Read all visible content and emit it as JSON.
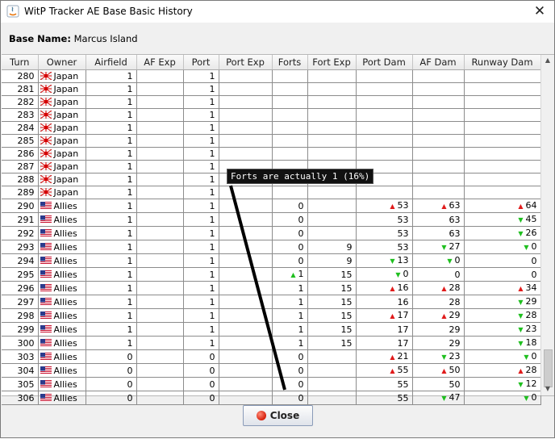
{
  "window": {
    "title": "WitP Tracker AE Base Basic History",
    "close_glyph": "✕"
  },
  "base": {
    "label": "Base Name:",
    "name": "Marcus Island"
  },
  "columns": [
    "Turn",
    "Owner",
    "Airfield",
    "AF Exp",
    "Port",
    "Port Exp",
    "Forts",
    "Fort Exp",
    "Port Dam",
    "AF Dam",
    "Runway Dam"
  ],
  "rows": [
    {
      "turn": "280",
      "owner": "Japan",
      "airfield": "1",
      "af_exp": "",
      "port": "1",
      "port_exp": "",
      "forts": "",
      "fort_exp": "",
      "port_dam": "",
      "af_dam": "",
      "runway_dam": ""
    },
    {
      "turn": "281",
      "owner": "Japan",
      "airfield": "1",
      "af_exp": "",
      "port": "1",
      "port_exp": "",
      "forts": "",
      "fort_exp": "",
      "port_dam": "",
      "af_dam": "",
      "runway_dam": ""
    },
    {
      "turn": "282",
      "owner": "Japan",
      "airfield": "1",
      "af_exp": "",
      "port": "1",
      "port_exp": "",
      "forts": "",
      "fort_exp": "",
      "port_dam": "",
      "af_dam": "",
      "runway_dam": ""
    },
    {
      "turn": "283",
      "owner": "Japan",
      "airfield": "1",
      "af_exp": "",
      "port": "1",
      "port_exp": "",
      "forts": "",
      "fort_exp": "",
      "port_dam": "",
      "af_dam": "",
      "runway_dam": ""
    },
    {
      "turn": "284",
      "owner": "Japan",
      "airfield": "1",
      "af_exp": "",
      "port": "1",
      "port_exp": "",
      "forts": "",
      "fort_exp": "",
      "port_dam": "",
      "af_dam": "",
      "runway_dam": ""
    },
    {
      "turn": "285",
      "owner": "Japan",
      "airfield": "1",
      "af_exp": "",
      "port": "1",
      "port_exp": "",
      "forts": "",
      "fort_exp": "",
      "port_dam": "",
      "af_dam": "",
      "runway_dam": ""
    },
    {
      "turn": "286",
      "owner": "Japan",
      "airfield": "1",
      "af_exp": "",
      "port": "1",
      "port_exp": "",
      "forts": "",
      "fort_exp": "",
      "port_dam": "",
      "af_dam": "",
      "runway_dam": ""
    },
    {
      "turn": "287",
      "owner": "Japan",
      "airfield": "1",
      "af_exp": "",
      "port": "1",
      "port_exp": "",
      "forts": "",
      "fort_exp": "",
      "port_dam": "",
      "af_dam": "",
      "runway_dam": ""
    },
    {
      "turn": "288",
      "owner": "Japan",
      "airfield": "1",
      "af_exp": "",
      "port": "1",
      "port_exp": "",
      "forts": "",
      "fort_exp": "",
      "port_dam": "",
      "af_dam": "",
      "runway_dam": ""
    },
    {
      "turn": "289",
      "owner": "Japan",
      "airfield": "1",
      "af_exp": "",
      "port": "1",
      "port_exp": "",
      "forts": "",
      "fort_exp": "",
      "port_dam": "",
      "af_dam": "",
      "runway_dam": ""
    },
    {
      "turn": "290",
      "owner": "Allies",
      "airfield": "1",
      "af_exp": "",
      "port": "1",
      "port_exp": "",
      "forts": "0",
      "fort_exp": "",
      "port_dam": "53",
      "port_dam_trend": "up",
      "af_dam": "63",
      "af_dam_trend": "up",
      "runway_dam": "64",
      "runway_dam_trend": "up"
    },
    {
      "turn": "291",
      "owner": "Allies",
      "airfield": "1",
      "af_exp": "",
      "port": "1",
      "port_exp": "",
      "forts": "0",
      "fort_exp": "",
      "port_dam": "53",
      "af_dam": "63",
      "runway_dam": "45",
      "runway_dam_trend": "down"
    },
    {
      "turn": "292",
      "owner": "Allies",
      "airfield": "1",
      "af_exp": "",
      "port": "1",
      "port_exp": "",
      "forts": "0",
      "fort_exp": "",
      "port_dam": "53",
      "af_dam": "63",
      "runway_dam": "26",
      "runway_dam_trend": "down"
    },
    {
      "turn": "293",
      "owner": "Allies",
      "airfield": "1",
      "af_exp": "",
      "port": "1",
      "port_exp": "",
      "forts": "0",
      "fort_exp": "9",
      "port_dam": "53",
      "af_dam": "27",
      "af_dam_trend": "down",
      "runway_dam": "0",
      "runway_dam_trend": "down"
    },
    {
      "turn": "294",
      "owner": "Allies",
      "airfield": "1",
      "af_exp": "",
      "port": "1",
      "port_exp": "",
      "forts": "0",
      "fort_exp": "9",
      "port_dam": "13",
      "port_dam_trend": "down",
      "af_dam": "0",
      "af_dam_trend": "down",
      "runway_dam": "0"
    },
    {
      "turn": "295",
      "owner": "Allies",
      "airfield": "1",
      "af_exp": "",
      "port": "1",
      "port_exp": "",
      "forts": "1",
      "forts_trend": "up_green",
      "fort_exp": "15",
      "port_dam": "0",
      "port_dam_trend": "down",
      "af_dam": "0",
      "runway_dam": "0"
    },
    {
      "turn": "296",
      "owner": "Allies",
      "airfield": "1",
      "af_exp": "",
      "port": "1",
      "port_exp": "",
      "forts": "1",
      "fort_exp": "15",
      "port_dam": "16",
      "port_dam_trend": "up",
      "af_dam": "28",
      "af_dam_trend": "up",
      "runway_dam": "34",
      "runway_dam_trend": "up"
    },
    {
      "turn": "297",
      "owner": "Allies",
      "airfield": "1",
      "af_exp": "",
      "port": "1",
      "port_exp": "",
      "forts": "1",
      "fort_exp": "15",
      "port_dam": "16",
      "af_dam": "28",
      "runway_dam": "29",
      "runway_dam_trend": "down"
    },
    {
      "turn": "298",
      "owner": "Allies",
      "airfield": "1",
      "af_exp": "",
      "port": "1",
      "port_exp": "",
      "forts": "1",
      "fort_exp": "15",
      "port_dam": "17",
      "port_dam_trend": "up",
      "af_dam": "29",
      "af_dam_trend": "up",
      "runway_dam": "28",
      "runway_dam_trend": "down"
    },
    {
      "turn": "299",
      "owner": "Allies",
      "airfield": "1",
      "af_exp": "",
      "port": "1",
      "port_exp": "",
      "forts": "1",
      "fort_exp": "15",
      "port_dam": "17",
      "af_dam": "29",
      "runway_dam": "23",
      "runway_dam_trend": "down"
    },
    {
      "turn": "300",
      "owner": "Allies",
      "airfield": "1",
      "af_exp": "",
      "port": "1",
      "port_exp": "",
      "forts": "1",
      "fort_exp": "15",
      "port_dam": "17",
      "af_dam": "29",
      "runway_dam": "18",
      "runway_dam_trend": "down"
    },
    {
      "turn": "303",
      "owner": "Allies",
      "airfield": "0",
      "af_exp": "",
      "port": "0",
      "port_exp": "",
      "forts": "0",
      "fort_exp": "",
      "port_dam": "21",
      "port_dam_trend": "up",
      "af_dam": "23",
      "af_dam_trend": "down",
      "runway_dam": "0",
      "runway_dam_trend": "down"
    },
    {
      "turn": "304",
      "owner": "Allies",
      "airfield": "0",
      "af_exp": "",
      "port": "0",
      "port_exp": "",
      "forts": "0",
      "fort_exp": "",
      "port_dam": "55",
      "port_dam_trend": "up",
      "af_dam": "50",
      "af_dam_trend": "up",
      "runway_dam": "28",
      "runway_dam_trend": "up"
    },
    {
      "turn": "305",
      "owner": "Allies",
      "airfield": "0",
      "af_exp": "",
      "port": "0",
      "port_exp": "",
      "forts": "0",
      "fort_exp": "",
      "port_dam": "55",
      "af_dam": "50",
      "runway_dam": "12",
      "runway_dam_trend": "down"
    },
    {
      "turn": "306",
      "owner": "Allies",
      "airfield": "0",
      "af_exp": "",
      "port": "0",
      "port_exp": "",
      "forts": "0",
      "fort_exp": "",
      "port_dam": "55",
      "af_dam": "47",
      "af_dam_trend": "down",
      "runway_dam": "0",
      "runway_dam_trend": "down"
    }
  ],
  "annotation": {
    "text": "Forts are actually 1 (16%)"
  },
  "buttons": {
    "close_label": "Close"
  },
  "colors": {
    "trend_up": "#e01b1b",
    "trend_down": "#1fbf1f"
  }
}
